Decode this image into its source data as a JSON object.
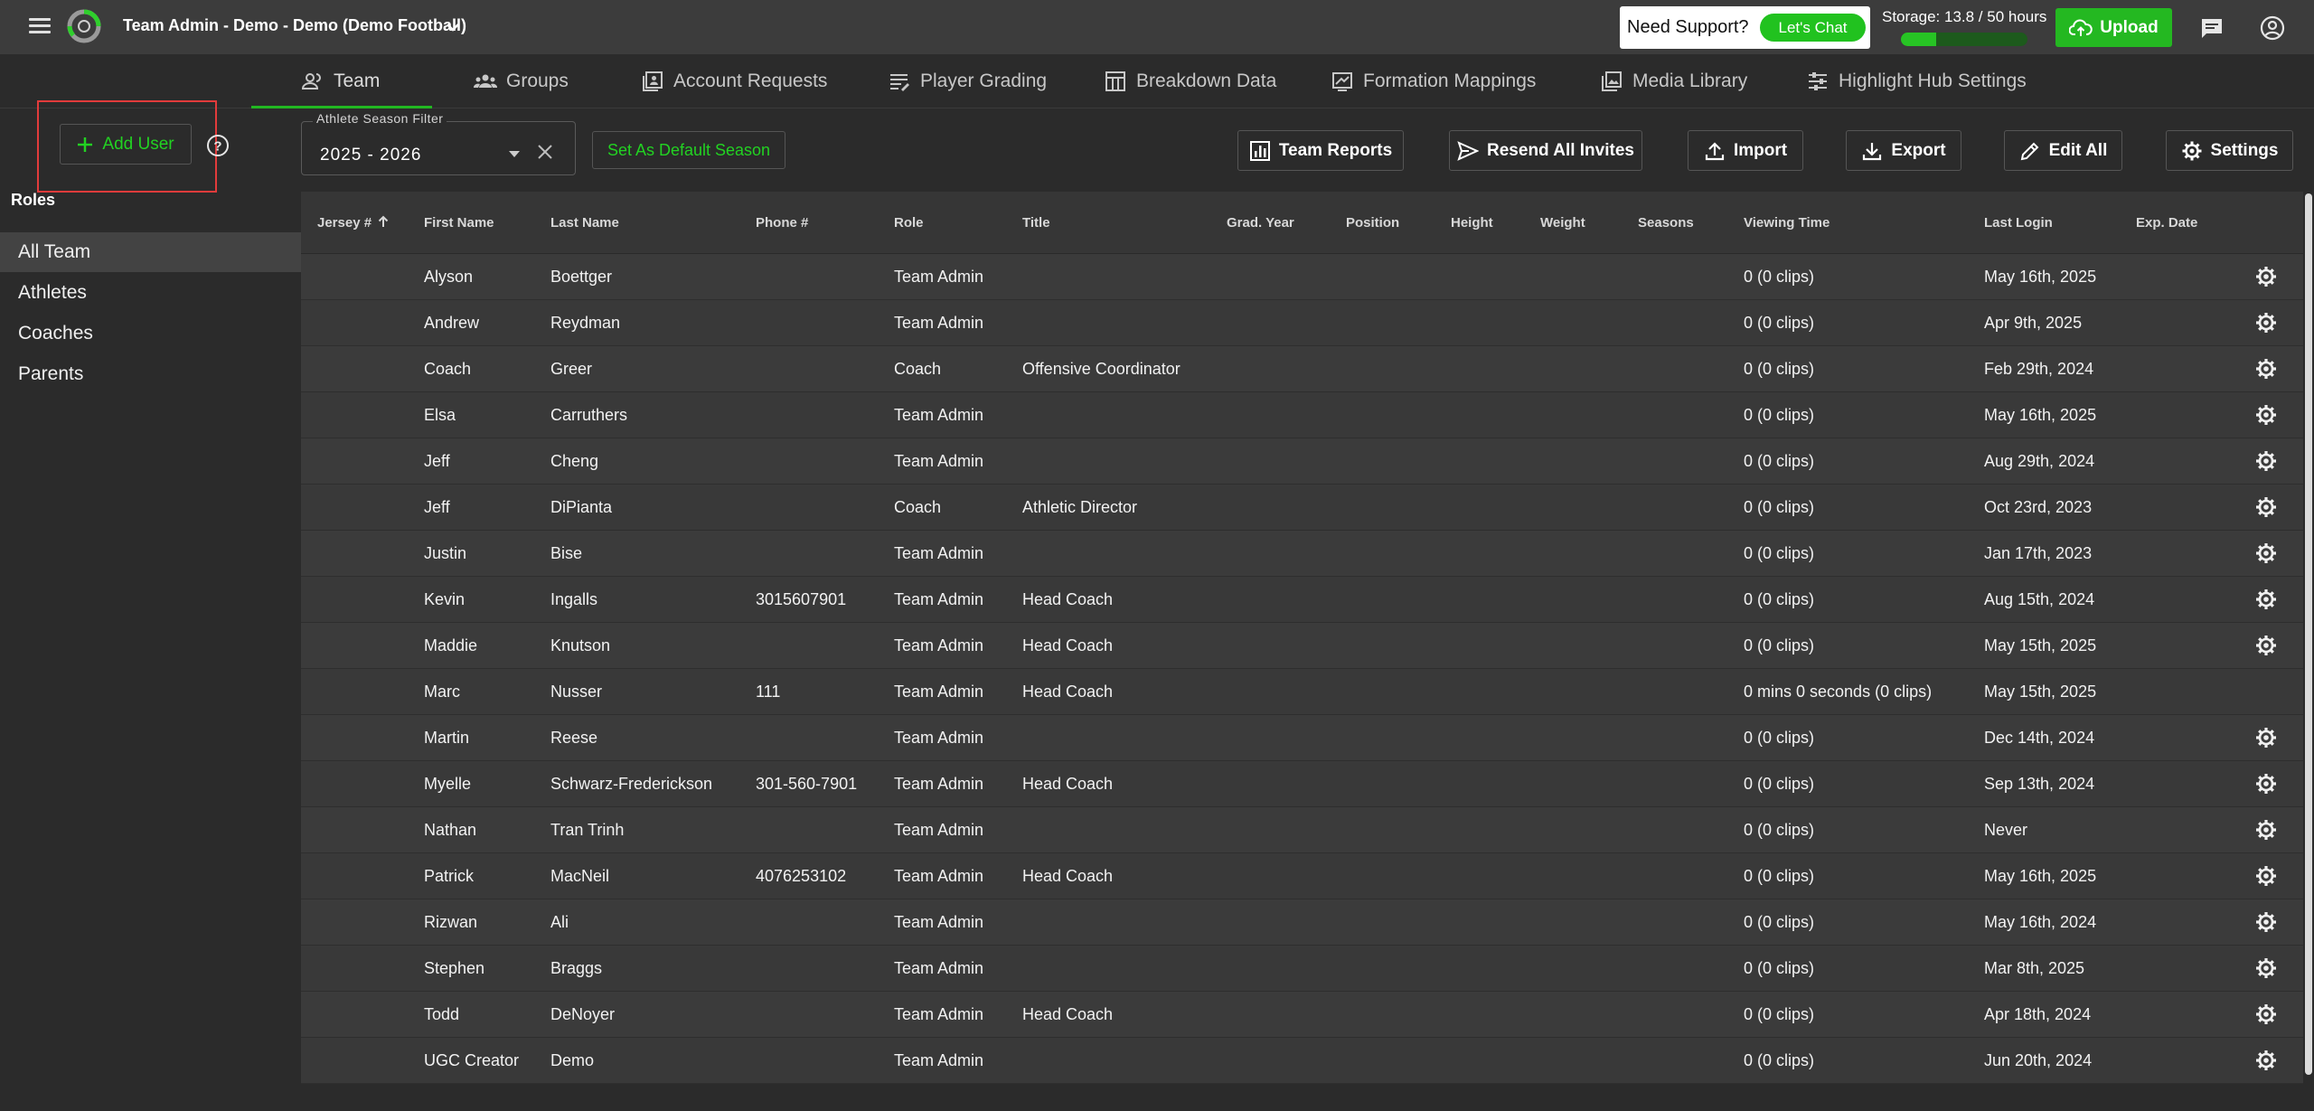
{
  "topbar": {
    "team_title": "Team Admin - Demo - Demo (Demo Football)",
    "support_text": "Need Support?",
    "lets_chat": "Let's Chat",
    "storage": "Storage: 13.8 / 50 hours",
    "storage_fraction": 0.276,
    "upload": "Upload"
  },
  "tabs": [
    {
      "label": "Team",
      "icon": "team-icon",
      "active": true
    },
    {
      "label": "Groups",
      "icon": "groups-icon"
    },
    {
      "label": "Account Requests",
      "icon": "account-requests-icon"
    },
    {
      "label": "Player Grading",
      "icon": "player-grading-icon"
    },
    {
      "label": "Breakdown Data",
      "icon": "breakdown-data-icon"
    },
    {
      "label": "Formation Mappings",
      "icon": "formation-mappings-icon"
    },
    {
      "label": "Media Library",
      "icon": "media-library-icon"
    },
    {
      "label": "Highlight Hub Settings",
      "icon": "highlight-hub-settings-icon"
    }
  ],
  "sidebar": {
    "add_user": "Add User",
    "roles_title": "Roles",
    "roles": [
      "All Team",
      "Athletes",
      "Coaches",
      "Parents"
    ],
    "active_role": "All Team"
  },
  "filter": {
    "label": "Athlete Season Filter",
    "value": "2025 - 2026",
    "default_season_button": "Set As Default Season"
  },
  "toolbar": {
    "team_reports": "Team Reports",
    "resend_invites": "Resend All Invites",
    "import": "Import",
    "export": "Export",
    "edit_all": "Edit All",
    "settings": "Settings"
  },
  "table": {
    "columns": [
      "Jersey #",
      "First Name",
      "Last Name",
      "Phone #",
      "Role",
      "Title",
      "Grad. Year",
      "Position",
      "Height",
      "Weight",
      "Seasons",
      "Viewing Time",
      "Last Login",
      "Exp. Date"
    ],
    "sort_column": "Jersey #",
    "rows": [
      {
        "first": "Alyson",
        "last": "Boettger",
        "phone": "",
        "role": "Team Admin",
        "title": "",
        "viewing": "0 (0 clips)",
        "login": "May 16th, 2025",
        "gear": true
      },
      {
        "first": "Andrew",
        "last": "Reydman",
        "phone": "",
        "role": "Team Admin",
        "title": "",
        "viewing": "0 (0 clips)",
        "login": "Apr 9th, 2025",
        "gear": true
      },
      {
        "first": "Coach",
        "last": "Greer",
        "phone": "",
        "role": "Coach",
        "title": "Offensive Coordinator",
        "viewing": "0 (0 clips)",
        "login": "Feb 29th, 2024",
        "gear": true
      },
      {
        "first": "Elsa",
        "last": "Carruthers",
        "phone": "",
        "role": "Team Admin",
        "title": "",
        "viewing": "0 (0 clips)",
        "login": "May 16th, 2025",
        "gear": true
      },
      {
        "first": "Jeff",
        "last": "Cheng",
        "phone": "",
        "role": "Team Admin",
        "title": "",
        "viewing": "0 (0 clips)",
        "login": "Aug 29th, 2024",
        "gear": true
      },
      {
        "first": "Jeff",
        "last": "DiPianta",
        "phone": "",
        "role": "Coach",
        "title": "Athletic Director",
        "viewing": "0 (0 clips)",
        "login": "Oct 23rd, 2023",
        "gear": true
      },
      {
        "first": "Justin",
        "last": "Bise",
        "phone": "",
        "role": "Team Admin",
        "title": "",
        "viewing": "0 (0 clips)",
        "login": "Jan 17th, 2023",
        "gear": true
      },
      {
        "first": "Kevin",
        "last": "Ingalls",
        "phone": "3015607901",
        "role": "Team Admin",
        "title": "Head Coach",
        "viewing": "0 (0 clips)",
        "login": "Aug 15th, 2024",
        "gear": true
      },
      {
        "first": "Maddie",
        "last": "Knutson",
        "phone": "",
        "role": "Team Admin",
        "title": "Head Coach",
        "viewing": "0 (0 clips)",
        "login": "May 15th, 2025",
        "gear": true
      },
      {
        "first": "Marc",
        "last": "Nusser",
        "phone": "111",
        "role": "Team Admin",
        "title": "Head Coach",
        "viewing": "0 mins 0 seconds (0 clips)",
        "login": "May 15th, 2025",
        "gear": false
      },
      {
        "first": "Martin",
        "last": "Reese",
        "phone": "",
        "role": "Team Admin",
        "title": "",
        "viewing": "0 (0 clips)",
        "login": "Dec 14th, 2024",
        "gear": true
      },
      {
        "first": "Myelle",
        "last": "Schwarz-Frederickson",
        "phone": "301-560-7901",
        "role": "Team Admin",
        "title": "Head Coach",
        "viewing": "0 (0 clips)",
        "login": "Sep 13th, 2024",
        "gear": true
      },
      {
        "first": "Nathan",
        "last": "Tran Trinh",
        "phone": "",
        "role": "Team Admin",
        "title": "",
        "viewing": "0 (0 clips)",
        "login": "Never",
        "gear": true
      },
      {
        "first": "Patrick",
        "last": "MacNeil",
        "phone": "4076253102",
        "role": "Team Admin",
        "title": "Head Coach",
        "viewing": "0 (0 clips)",
        "login": "May 16th, 2025",
        "gear": true
      },
      {
        "first": "Rizwan",
        "last": "Ali",
        "phone": "",
        "role": "Team Admin",
        "title": "",
        "viewing": "0 (0 clips)",
        "login": "May 16th, 2024",
        "gear": true
      },
      {
        "first": "Stephen",
        "last": "Braggs",
        "phone": "",
        "role": "Team Admin",
        "title": "",
        "viewing": "0 (0 clips)",
        "login": "Mar 8th, 2025",
        "gear": true
      },
      {
        "first": "Todd",
        "last": "DeNoyer",
        "phone": "",
        "role": "Team Admin",
        "title": "Head Coach",
        "viewing": "0 (0 clips)",
        "login": "Apr 18th, 2024",
        "gear": true
      },
      {
        "first": "UGC Creator",
        "last": "Demo",
        "phone": "",
        "role": "Team Admin",
        "title": "",
        "viewing": "0 (0 clips)",
        "login": "Jun 20th, 2024",
        "gear": true
      }
    ]
  },
  "colors": {
    "accent_green": "#22d222",
    "highlight_red": "#e23b3b",
    "topbar": "#3c3c3c",
    "background": "#2b2b2b"
  }
}
